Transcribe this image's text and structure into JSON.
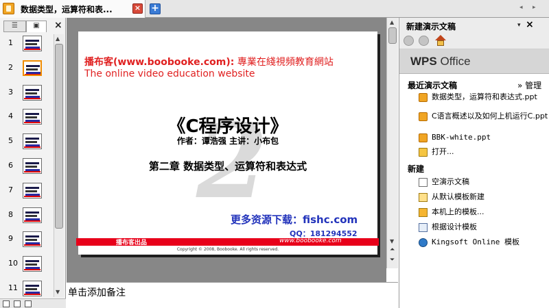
{
  "tabbar": {
    "document_tab_title": "数据类型，运算符和表...",
    "close_glyph": "×",
    "new_tab_glyph": "+",
    "scroll_left_glyph": "◂",
    "scroll_right_glyph": "▸"
  },
  "left_pane": {
    "outline_tab_glyph": "☰",
    "slides_tab_glyph": "▣",
    "close_glyph": "×",
    "slide_numbers": [
      "1",
      "2",
      "3",
      "4",
      "5",
      "6",
      "7",
      "8",
      "9",
      "10",
      "11"
    ],
    "selected_slide": 2
  },
  "slide": {
    "site_brand": "播布客(www.boobooke.com):",
    "site_cn": "專業在綫視頻教育網站",
    "tagline": "The online video education website",
    "watermark": "2",
    "book_title": "《C程序设计》",
    "authors": "作者：谭浩强      主讲：小布包",
    "chapter": "第二章  数据类型、运算符和表达式",
    "download": "更多资源下载：fishc.com",
    "qq": "QQ：181294552",
    "band_left": "播布客出品",
    "band_right": "www.boobooke.com",
    "copyright": "Copyright © 2008, Boobooke. All rights reserved."
  },
  "notes": {
    "placeholder": "单击添加备注"
  },
  "task_pane": {
    "title": "新建演示文稿",
    "dropdown_glyph": "▾",
    "close_glyph": "×",
    "logo_wps": "WPS",
    "logo_office": "Office",
    "recent_heading": "最近演示文稿",
    "manage_label": "» 管理",
    "recent_files": [
      "数据类型，运算符和表达式.ppt",
      "C语言概述以及如何上机运行C.ppt",
      "BBK-white.ppt"
    ],
    "open_label": "打开...",
    "new_heading": "新建",
    "new_items": [
      "空演示文稿",
      "从默认模板新建",
      "本机上的模板...",
      "根据设计模板",
      "Kingsoft Online 模板"
    ]
  }
}
